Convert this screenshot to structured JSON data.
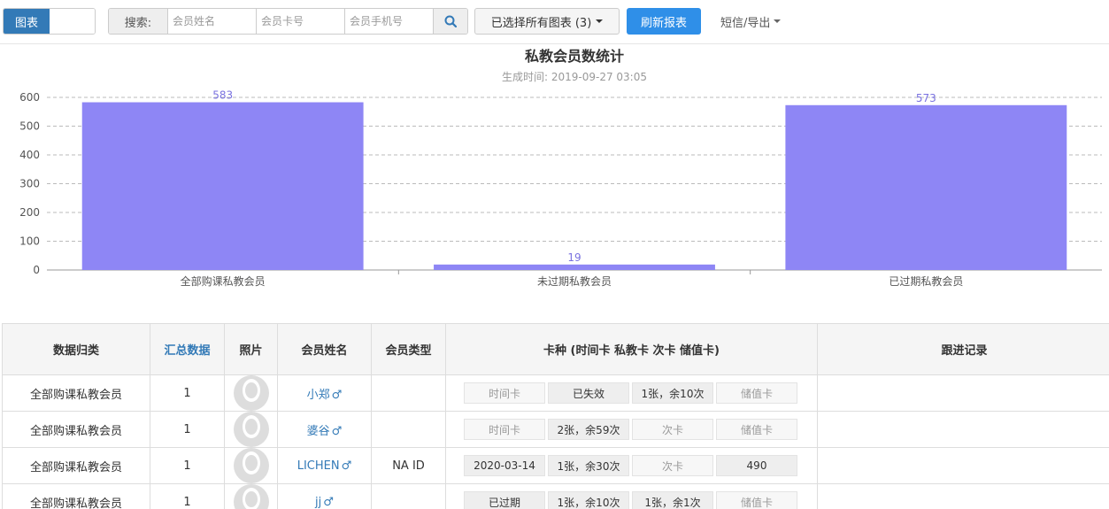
{
  "toolbar": {
    "view_toggle_label": "图表",
    "search_label": "搜索:",
    "search_name_placeholder": "会员姓名",
    "search_card_placeholder": "会员卡号",
    "search_phone_placeholder": "会员手机号",
    "chart_select_label": "已选择所有图表 (3)",
    "refresh_label": "刷新报表",
    "sms_label": "短信/导出"
  },
  "chart_data": {
    "type": "bar",
    "title": "私教会员数统计",
    "subtitle": "生成时间: 2019-09-27 03:05",
    "categories": [
      "全部购课私教会员",
      "未过期私教会员",
      "已过期私教会员"
    ],
    "values": [
      583,
      19,
      573
    ],
    "ylim": [
      0,
      600
    ],
    "yticks": [
      0,
      100,
      200,
      300,
      400,
      500,
      600
    ],
    "grid": true,
    "bar_color": "#8e86f5"
  },
  "table": {
    "headers": [
      "数据归类",
      "汇总数据",
      "照片",
      "会员姓名",
      "会员类型",
      "卡种 (时间卡 私教卡 次卡 储值卡)",
      "跟进记录"
    ],
    "rows": [
      {
        "category": "全部购课私教会员",
        "count": "1",
        "name": "小郑",
        "type": "",
        "cards": [
          {
            "text": "时间卡",
            "active": false
          },
          {
            "text": "已失效",
            "active": true
          },
          {
            "text": "1张，余10次",
            "active": true
          },
          {
            "text": "储值卡",
            "active": false
          }
        ]
      },
      {
        "category": "全部购课私教会员",
        "count": "1",
        "name": "婆谷",
        "type": "",
        "cards": [
          {
            "text": "时间卡",
            "active": false
          },
          {
            "text": "2张，余59次",
            "active": true
          },
          {
            "text": "次卡",
            "active": false
          },
          {
            "text": "储值卡",
            "active": false
          }
        ]
      },
      {
        "category": "全部购课私教会员",
        "count": "1",
        "name": "LICHEN",
        "type": "NA ID",
        "cards": [
          {
            "text": "2020-03-14",
            "active": true
          },
          {
            "text": "1张，余30次",
            "active": true
          },
          {
            "text": "次卡",
            "active": false
          },
          {
            "text": "490",
            "active": true
          }
        ]
      },
      {
        "category": "全部购课私教会员",
        "count": "1",
        "name": "jj",
        "type": "",
        "cards": [
          {
            "text": "已过期",
            "active": true
          },
          {
            "text": "1张，余10次",
            "active": true
          },
          {
            "text": "1张，余1次",
            "active": true
          },
          {
            "text": "储值卡",
            "active": false
          }
        ]
      }
    ]
  },
  "icons": {
    "search": "search-icon",
    "male": "♂",
    "avatar": "avatar-placeholder-icon"
  }
}
